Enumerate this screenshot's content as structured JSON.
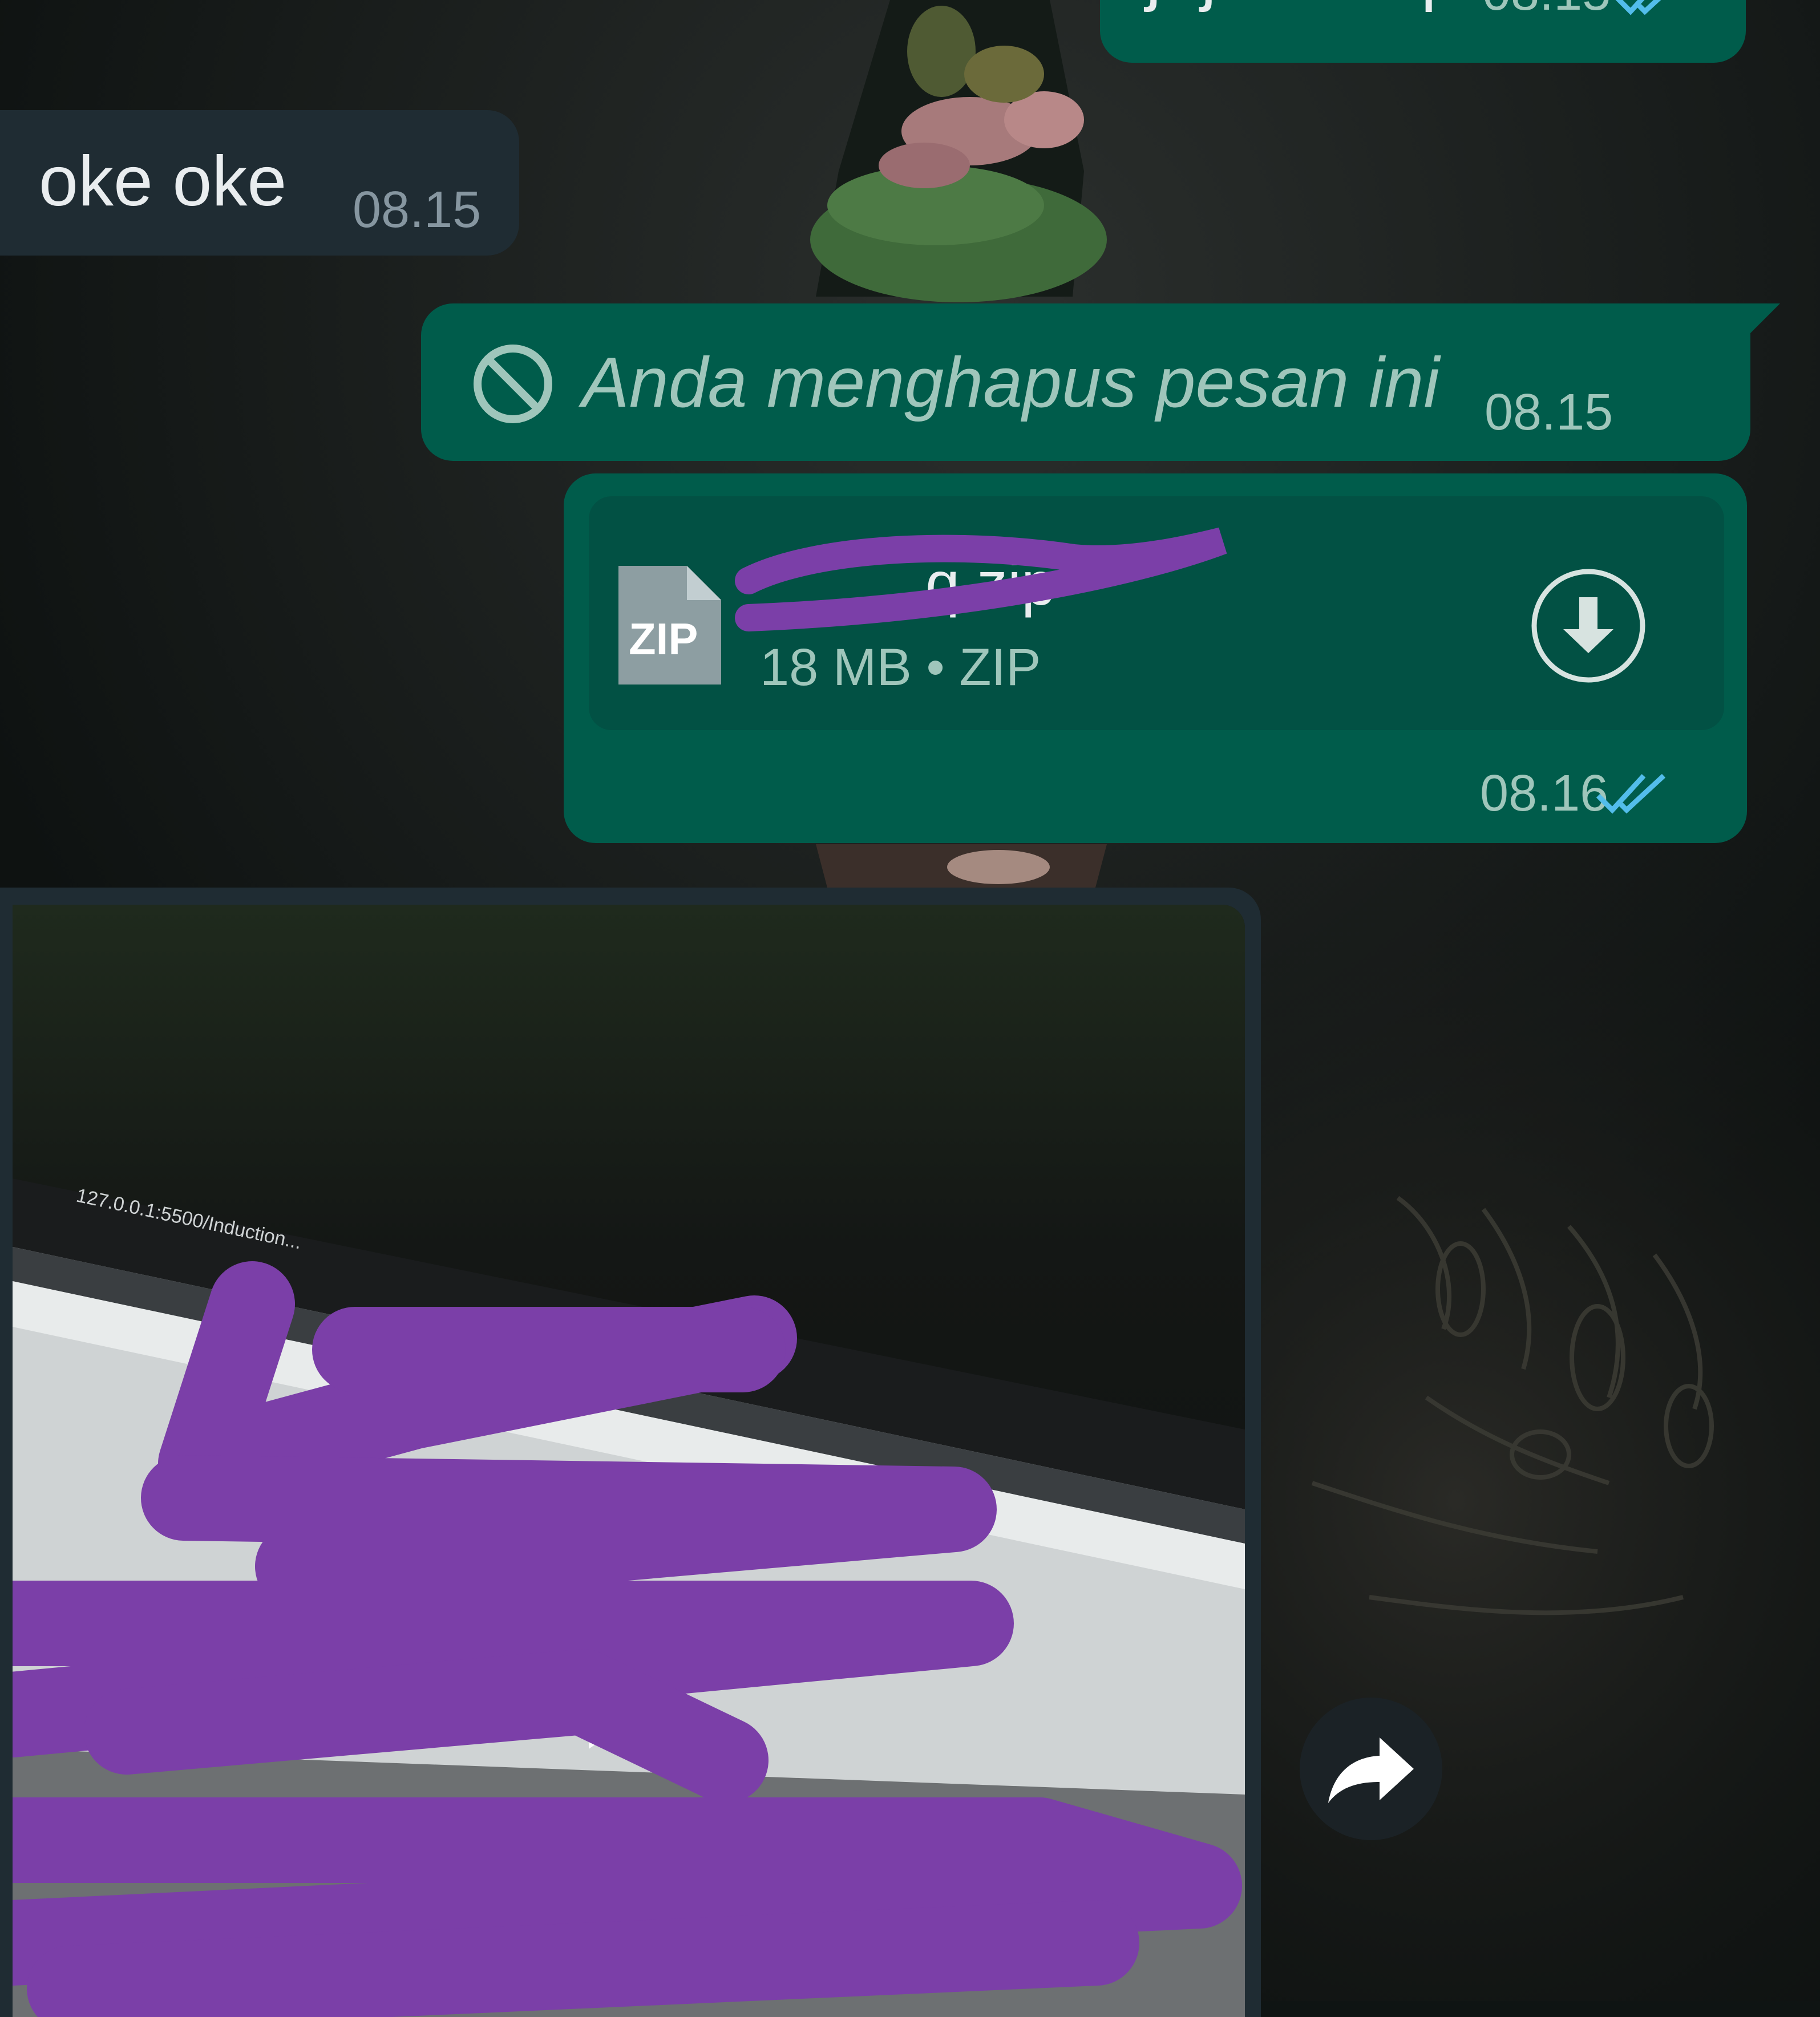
{
  "messages": [
    {
      "id": "partial-top",
      "direction": "outgoing",
      "text": "jajal sit iq",
      "time": "08.15",
      "status": "read"
    },
    {
      "id": "oke",
      "direction": "incoming",
      "text": "oke oke",
      "time": "08.15"
    },
    {
      "id": "deleted",
      "direction": "outgoing",
      "text": "Anda menghapus pesan ini",
      "time": "08.15",
      "icon": "blocked-icon"
    },
    {
      "id": "zip",
      "direction": "outgoing",
      "type": "document",
      "file_icon_label": "ZIP",
      "file_name": "q.zip",
      "file_meta": "18 MB • ZIP",
      "time": "08.16",
      "status": "read",
      "action_icon": "download-icon"
    },
    {
      "id": "video",
      "direction": "incoming",
      "type": "video",
      "overlay_icon": "play-icon",
      "preview_url_text": "127.0.0.1:5500/Induction..."
    }
  ],
  "actions": {
    "forward_icon": "forward-icon"
  },
  "colors": {
    "outgoing_bubble": "#005c4b",
    "incoming_bubble": "#1f2c33",
    "read_ticks": "#53bdeb",
    "redaction": "#7b3fa8",
    "background": "#0f1413"
  }
}
